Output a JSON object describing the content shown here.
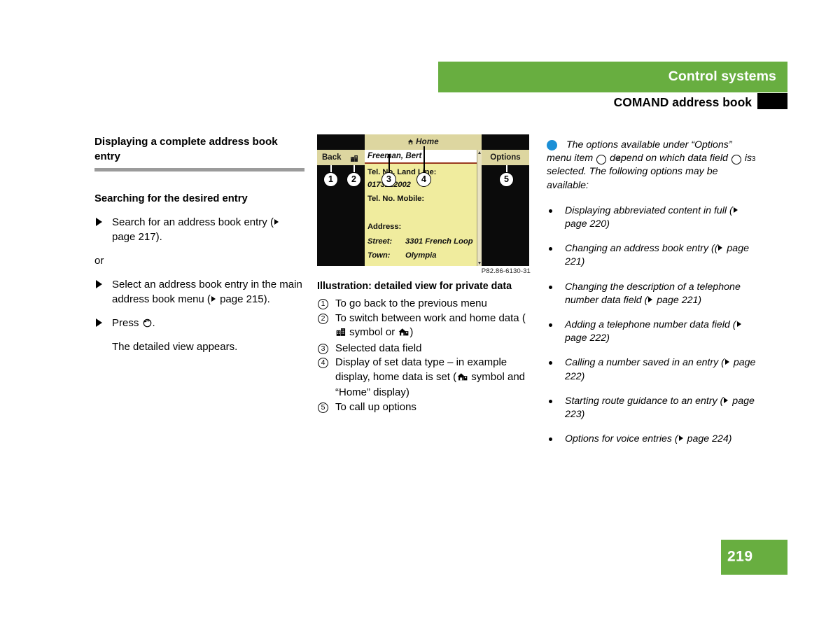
{
  "header": {
    "chapter_title": "Control systems",
    "section_title": "COMAND address book"
  },
  "left_column": {
    "heading": "Displaying a complete address book entry",
    "subheading": "Searching for the desired entry",
    "steps": [
      {
        "text_before": "Search for an address book entry (",
        "page_label": " page 217",
        "text_after": ")."
      },
      {
        "text_before": "Select an address book entry in the main address book menu (",
        "page_label": " page 215",
        "text_after": ")."
      }
    ],
    "or_label": "or",
    "press_step_before": "Press ",
    "press_step_after": ".",
    "result_text": "The detailed view appears."
  },
  "comand_screen": {
    "top_title": "Home",
    "back_button": "Back",
    "options_button": "Options",
    "name_field": "Freeman, Bert",
    "rows": [
      {
        "label": "Tel. No. Land Line:"
      },
      {
        "value": "0173122002"
      },
      {
        "label": "Tel. No. Mobile:"
      },
      {
        "label": "Address:"
      }
    ],
    "street_label": "Street:",
    "street_value": "3301 French Loop",
    "town_label": "Town:",
    "town_value": "Olympia",
    "callouts": [
      "1",
      "2",
      "3",
      "4",
      "5"
    ],
    "photo_code": "P82.86-6130-31"
  },
  "illustration": {
    "caption": "Illustration: detailed view for private data",
    "items": [
      {
        "num": "1",
        "text": "To go back to the previous menu"
      },
      {
        "num": "2",
        "text_a": "To switch between work and home data (",
        "text_b": " symbol or ",
        "text_c": ")"
      },
      {
        "num": "3",
        "text": "Selected data field"
      },
      {
        "num": "4",
        "text_a": "Display of set data type – in example display, home data is set (",
        "text_b": " symbol and “Home” display)"
      },
      {
        "num": "5",
        "text": "To call up options"
      }
    ]
  },
  "note": {
    "para_a": "The options available under “Options” menu item ",
    "para_b": " depend on which data field ",
    "para_c": " is selected. The following options may be available:",
    "ref_item": "4",
    "ref_field": "3",
    "bullets": [
      {
        "text": "Displaying abbreviated content in full (",
        "page": " page 220",
        "tail": ")"
      },
      {
        "text": "Changing an address book entry ((",
        "page": " page 221",
        "tail": ")"
      },
      {
        "text": "Changing the description of a telephone number data field (",
        "page": " page 221",
        "tail": ")"
      },
      {
        "text": "Adding a telephone number data field (",
        "page": " page 222",
        "tail": ")"
      },
      {
        "text": "Calling a number saved in an entry (",
        "page": " page 222",
        "tail": ")"
      },
      {
        "text": "Starting route guidance to an entry (",
        "page": " page 223",
        "tail": ")"
      },
      {
        "text": "Options for voice entries (",
        "page": " page 224",
        "tail": ")"
      }
    ]
  },
  "footer": {
    "page_number": "219"
  },
  "colors": {
    "brand_green": "#68AE40",
    "info_blue": "#1b8fd6",
    "screen_yellow": "#f0ec9e",
    "screen_tan": "#ddd6a0",
    "screen_black": "#0b0b0b",
    "rule_gray": "#9b9b9b"
  }
}
